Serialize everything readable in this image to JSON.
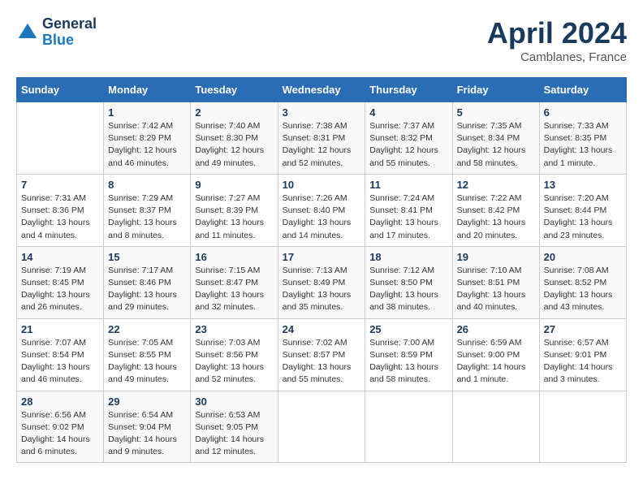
{
  "header": {
    "logo_line1": "General",
    "logo_line2": "Blue",
    "month": "April 2024",
    "location": "Camblanes, France"
  },
  "weekdays": [
    "Sunday",
    "Monday",
    "Tuesday",
    "Wednesday",
    "Thursday",
    "Friday",
    "Saturday"
  ],
  "weeks": [
    [
      {
        "day": "",
        "info": ""
      },
      {
        "day": "1",
        "info": "Sunrise: 7:42 AM\nSunset: 8:29 PM\nDaylight: 12 hours\nand 46 minutes."
      },
      {
        "day": "2",
        "info": "Sunrise: 7:40 AM\nSunset: 8:30 PM\nDaylight: 12 hours\nand 49 minutes."
      },
      {
        "day": "3",
        "info": "Sunrise: 7:38 AM\nSunset: 8:31 PM\nDaylight: 12 hours\nand 52 minutes."
      },
      {
        "day": "4",
        "info": "Sunrise: 7:37 AM\nSunset: 8:32 PM\nDaylight: 12 hours\nand 55 minutes."
      },
      {
        "day": "5",
        "info": "Sunrise: 7:35 AM\nSunset: 8:34 PM\nDaylight: 12 hours\nand 58 minutes."
      },
      {
        "day": "6",
        "info": "Sunrise: 7:33 AM\nSunset: 8:35 PM\nDaylight: 13 hours\nand 1 minute."
      }
    ],
    [
      {
        "day": "7",
        "info": "Sunrise: 7:31 AM\nSunset: 8:36 PM\nDaylight: 13 hours\nand 4 minutes."
      },
      {
        "day": "8",
        "info": "Sunrise: 7:29 AM\nSunset: 8:37 PM\nDaylight: 13 hours\nand 8 minutes."
      },
      {
        "day": "9",
        "info": "Sunrise: 7:27 AM\nSunset: 8:39 PM\nDaylight: 13 hours\nand 11 minutes."
      },
      {
        "day": "10",
        "info": "Sunrise: 7:26 AM\nSunset: 8:40 PM\nDaylight: 13 hours\nand 14 minutes."
      },
      {
        "day": "11",
        "info": "Sunrise: 7:24 AM\nSunset: 8:41 PM\nDaylight: 13 hours\nand 17 minutes."
      },
      {
        "day": "12",
        "info": "Sunrise: 7:22 AM\nSunset: 8:42 PM\nDaylight: 13 hours\nand 20 minutes."
      },
      {
        "day": "13",
        "info": "Sunrise: 7:20 AM\nSunset: 8:44 PM\nDaylight: 13 hours\nand 23 minutes."
      }
    ],
    [
      {
        "day": "14",
        "info": "Sunrise: 7:19 AM\nSunset: 8:45 PM\nDaylight: 13 hours\nand 26 minutes."
      },
      {
        "day": "15",
        "info": "Sunrise: 7:17 AM\nSunset: 8:46 PM\nDaylight: 13 hours\nand 29 minutes."
      },
      {
        "day": "16",
        "info": "Sunrise: 7:15 AM\nSunset: 8:47 PM\nDaylight: 13 hours\nand 32 minutes."
      },
      {
        "day": "17",
        "info": "Sunrise: 7:13 AM\nSunset: 8:49 PM\nDaylight: 13 hours\nand 35 minutes."
      },
      {
        "day": "18",
        "info": "Sunrise: 7:12 AM\nSunset: 8:50 PM\nDaylight: 13 hours\nand 38 minutes."
      },
      {
        "day": "19",
        "info": "Sunrise: 7:10 AM\nSunset: 8:51 PM\nDaylight: 13 hours\nand 40 minutes."
      },
      {
        "day": "20",
        "info": "Sunrise: 7:08 AM\nSunset: 8:52 PM\nDaylight: 13 hours\nand 43 minutes."
      }
    ],
    [
      {
        "day": "21",
        "info": "Sunrise: 7:07 AM\nSunset: 8:54 PM\nDaylight: 13 hours\nand 46 minutes."
      },
      {
        "day": "22",
        "info": "Sunrise: 7:05 AM\nSunset: 8:55 PM\nDaylight: 13 hours\nand 49 minutes."
      },
      {
        "day": "23",
        "info": "Sunrise: 7:03 AM\nSunset: 8:56 PM\nDaylight: 13 hours\nand 52 minutes."
      },
      {
        "day": "24",
        "info": "Sunrise: 7:02 AM\nSunset: 8:57 PM\nDaylight: 13 hours\nand 55 minutes."
      },
      {
        "day": "25",
        "info": "Sunrise: 7:00 AM\nSunset: 8:59 PM\nDaylight: 13 hours\nand 58 minutes."
      },
      {
        "day": "26",
        "info": "Sunrise: 6:59 AM\nSunset: 9:00 PM\nDaylight: 14 hours\nand 1 minute."
      },
      {
        "day": "27",
        "info": "Sunrise: 6:57 AM\nSunset: 9:01 PM\nDaylight: 14 hours\nand 3 minutes."
      }
    ],
    [
      {
        "day": "28",
        "info": "Sunrise: 6:56 AM\nSunset: 9:02 PM\nDaylight: 14 hours\nand 6 minutes."
      },
      {
        "day": "29",
        "info": "Sunrise: 6:54 AM\nSunset: 9:04 PM\nDaylight: 14 hours\nand 9 minutes."
      },
      {
        "day": "30",
        "info": "Sunrise: 6:53 AM\nSunset: 9:05 PM\nDaylight: 14 hours\nand 12 minutes."
      },
      {
        "day": "",
        "info": ""
      },
      {
        "day": "",
        "info": ""
      },
      {
        "day": "",
        "info": ""
      },
      {
        "day": "",
        "info": ""
      }
    ]
  ]
}
